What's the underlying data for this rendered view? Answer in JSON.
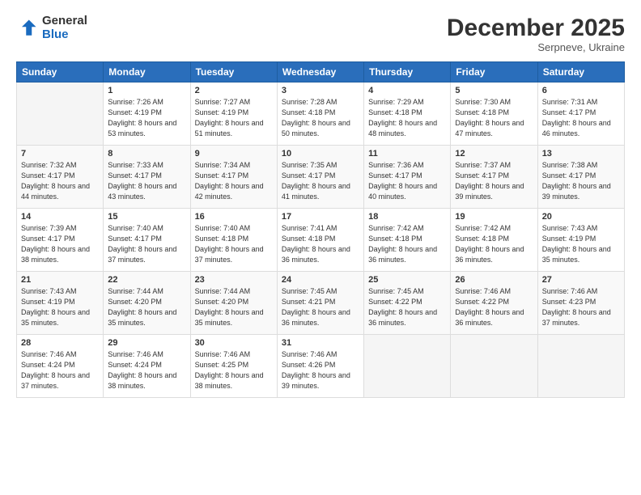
{
  "header": {
    "logo_general": "General",
    "logo_blue": "Blue",
    "month": "December 2025",
    "location": "Serpneve, Ukraine"
  },
  "weekdays": [
    "Sunday",
    "Monday",
    "Tuesday",
    "Wednesday",
    "Thursday",
    "Friday",
    "Saturday"
  ],
  "weeks": [
    [
      {
        "day": "",
        "sunrise": "",
        "sunset": "",
        "daylight": ""
      },
      {
        "day": "1",
        "sunrise": "Sunrise: 7:26 AM",
        "sunset": "Sunset: 4:19 PM",
        "daylight": "Daylight: 8 hours and 53 minutes."
      },
      {
        "day": "2",
        "sunrise": "Sunrise: 7:27 AM",
        "sunset": "Sunset: 4:19 PM",
        "daylight": "Daylight: 8 hours and 51 minutes."
      },
      {
        "day": "3",
        "sunrise": "Sunrise: 7:28 AM",
        "sunset": "Sunset: 4:18 PM",
        "daylight": "Daylight: 8 hours and 50 minutes."
      },
      {
        "day": "4",
        "sunrise": "Sunrise: 7:29 AM",
        "sunset": "Sunset: 4:18 PM",
        "daylight": "Daylight: 8 hours and 48 minutes."
      },
      {
        "day": "5",
        "sunrise": "Sunrise: 7:30 AM",
        "sunset": "Sunset: 4:18 PM",
        "daylight": "Daylight: 8 hours and 47 minutes."
      },
      {
        "day": "6",
        "sunrise": "Sunrise: 7:31 AM",
        "sunset": "Sunset: 4:17 PM",
        "daylight": "Daylight: 8 hours and 46 minutes."
      }
    ],
    [
      {
        "day": "7",
        "sunrise": "Sunrise: 7:32 AM",
        "sunset": "Sunset: 4:17 PM",
        "daylight": "Daylight: 8 hours and 44 minutes."
      },
      {
        "day": "8",
        "sunrise": "Sunrise: 7:33 AM",
        "sunset": "Sunset: 4:17 PM",
        "daylight": "Daylight: 8 hours and 43 minutes."
      },
      {
        "day": "9",
        "sunrise": "Sunrise: 7:34 AM",
        "sunset": "Sunset: 4:17 PM",
        "daylight": "Daylight: 8 hours and 42 minutes."
      },
      {
        "day": "10",
        "sunrise": "Sunrise: 7:35 AM",
        "sunset": "Sunset: 4:17 PM",
        "daylight": "Daylight: 8 hours and 41 minutes."
      },
      {
        "day": "11",
        "sunrise": "Sunrise: 7:36 AM",
        "sunset": "Sunset: 4:17 PM",
        "daylight": "Daylight: 8 hours and 40 minutes."
      },
      {
        "day": "12",
        "sunrise": "Sunrise: 7:37 AM",
        "sunset": "Sunset: 4:17 PM",
        "daylight": "Daylight: 8 hours and 39 minutes."
      },
      {
        "day": "13",
        "sunrise": "Sunrise: 7:38 AM",
        "sunset": "Sunset: 4:17 PM",
        "daylight": "Daylight: 8 hours and 39 minutes."
      }
    ],
    [
      {
        "day": "14",
        "sunrise": "Sunrise: 7:39 AM",
        "sunset": "Sunset: 4:17 PM",
        "daylight": "Daylight: 8 hours and 38 minutes."
      },
      {
        "day": "15",
        "sunrise": "Sunrise: 7:40 AM",
        "sunset": "Sunset: 4:17 PM",
        "daylight": "Daylight: 8 hours and 37 minutes."
      },
      {
        "day": "16",
        "sunrise": "Sunrise: 7:40 AM",
        "sunset": "Sunset: 4:18 PM",
        "daylight": "Daylight: 8 hours and 37 minutes."
      },
      {
        "day": "17",
        "sunrise": "Sunrise: 7:41 AM",
        "sunset": "Sunset: 4:18 PM",
        "daylight": "Daylight: 8 hours and 36 minutes."
      },
      {
        "day": "18",
        "sunrise": "Sunrise: 7:42 AM",
        "sunset": "Sunset: 4:18 PM",
        "daylight": "Daylight: 8 hours and 36 minutes."
      },
      {
        "day": "19",
        "sunrise": "Sunrise: 7:42 AM",
        "sunset": "Sunset: 4:18 PM",
        "daylight": "Daylight: 8 hours and 36 minutes."
      },
      {
        "day": "20",
        "sunrise": "Sunrise: 7:43 AM",
        "sunset": "Sunset: 4:19 PM",
        "daylight": "Daylight: 8 hours and 35 minutes."
      }
    ],
    [
      {
        "day": "21",
        "sunrise": "Sunrise: 7:43 AM",
        "sunset": "Sunset: 4:19 PM",
        "daylight": "Daylight: 8 hours and 35 minutes."
      },
      {
        "day": "22",
        "sunrise": "Sunrise: 7:44 AM",
        "sunset": "Sunset: 4:20 PM",
        "daylight": "Daylight: 8 hours and 35 minutes."
      },
      {
        "day": "23",
        "sunrise": "Sunrise: 7:44 AM",
        "sunset": "Sunset: 4:20 PM",
        "daylight": "Daylight: 8 hours and 35 minutes."
      },
      {
        "day": "24",
        "sunrise": "Sunrise: 7:45 AM",
        "sunset": "Sunset: 4:21 PM",
        "daylight": "Daylight: 8 hours and 36 minutes."
      },
      {
        "day": "25",
        "sunrise": "Sunrise: 7:45 AM",
        "sunset": "Sunset: 4:22 PM",
        "daylight": "Daylight: 8 hours and 36 minutes."
      },
      {
        "day": "26",
        "sunrise": "Sunrise: 7:46 AM",
        "sunset": "Sunset: 4:22 PM",
        "daylight": "Daylight: 8 hours and 36 minutes."
      },
      {
        "day": "27",
        "sunrise": "Sunrise: 7:46 AM",
        "sunset": "Sunset: 4:23 PM",
        "daylight": "Daylight: 8 hours and 37 minutes."
      }
    ],
    [
      {
        "day": "28",
        "sunrise": "Sunrise: 7:46 AM",
        "sunset": "Sunset: 4:24 PM",
        "daylight": "Daylight: 8 hours and 37 minutes."
      },
      {
        "day": "29",
        "sunrise": "Sunrise: 7:46 AM",
        "sunset": "Sunset: 4:24 PM",
        "daylight": "Daylight: 8 hours and 38 minutes."
      },
      {
        "day": "30",
        "sunrise": "Sunrise: 7:46 AM",
        "sunset": "Sunset: 4:25 PM",
        "daylight": "Daylight: 8 hours and 38 minutes."
      },
      {
        "day": "31",
        "sunrise": "Sunrise: 7:46 AM",
        "sunset": "Sunset: 4:26 PM",
        "daylight": "Daylight: 8 hours and 39 minutes."
      },
      {
        "day": "",
        "sunrise": "",
        "sunset": "",
        "daylight": ""
      },
      {
        "day": "",
        "sunrise": "",
        "sunset": "",
        "daylight": ""
      },
      {
        "day": "",
        "sunrise": "",
        "sunset": "",
        "daylight": ""
      }
    ]
  ]
}
